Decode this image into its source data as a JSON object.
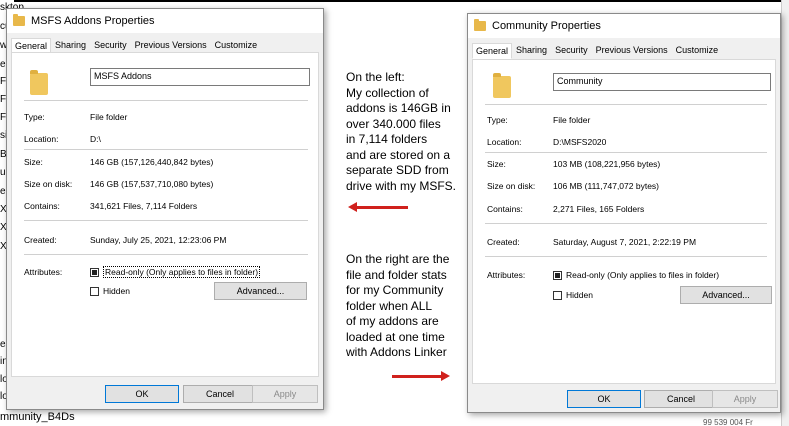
{
  "background": {
    "top_label": "sktop",
    "left_items": [
      "cu",
      "w",
      "e",
      "F",
      "F",
      "F",
      "si",
      "B",
      "u",
      "e",
      "X",
      "X",
      "X",
      "es",
      "in",
      "lo",
      "lo"
    ],
    "bottom_label": "mmunity_B4Ds",
    "bottom_right": "99 539 004   Fr"
  },
  "left_dialog": {
    "title": "MSFS Addons Properties",
    "tabs": [
      "General",
      "Sharing",
      "Security",
      "Previous Versions",
      "Customize"
    ],
    "active_tab": "General",
    "folder_name": "MSFS Addons",
    "fields": {
      "type_label": "Type:",
      "type_value": "File folder",
      "location_label": "Location:",
      "location_value": "D:\\",
      "size_label": "Size:",
      "size_value": "146 GB (157,126,440,842 bytes)",
      "size_on_disk_label": "Size on disk:",
      "size_on_disk_value": "146 GB (157,537,710,080 bytes)",
      "contains_label": "Contains:",
      "contains_value": "341,621 Files, 7,114 Folders",
      "created_label": "Created:",
      "created_value": "Sunday, July 25, 2021, 12:23:06 PM",
      "attributes_label": "Attributes:"
    },
    "readonly_label": "Read-only (Only applies to files in folder)",
    "hidden_label": "Hidden",
    "advanced_label": "Advanced...",
    "ok_label": "OK",
    "cancel_label": "Cancel",
    "apply_label": "Apply"
  },
  "right_dialog": {
    "title": "Community Properties",
    "tabs": [
      "General",
      "Sharing",
      "Security",
      "Previous Versions",
      "Customize"
    ],
    "active_tab": "General",
    "folder_name": "Community",
    "fields": {
      "type_label": "Type:",
      "type_value": "File folder",
      "location_label": "Location:",
      "location_value": "D:\\MSFS2020",
      "size_label": "Size:",
      "size_value": "103 MB (108,221,956 bytes)",
      "size_on_disk_label": "Size on disk:",
      "size_on_disk_value": "106 MB (111,747,072 bytes)",
      "contains_label": "Contains:",
      "contains_value": "2,271 Files, 165 Folders",
      "created_label": "Created:",
      "created_value": "Saturday, August 7, 2021, 2:22:19 PM",
      "attributes_label": "Attributes:"
    },
    "readonly_label": "Read-only (Only applies to files in folder)",
    "hidden_label": "Hidden",
    "advanced_label": "Advanced...",
    "ok_label": "OK",
    "cancel_label": "Cancel",
    "apply_label": "Apply"
  },
  "annotations": {
    "left_note": [
      "On the left:",
      "My collection of",
      "addons is 146GB  in",
      "over 340.000 files",
      "in 7,114 folders",
      "and are stored on a",
      "separate SDD from",
      "drive with my MSFS."
    ],
    "right_note": [
      "On the right are the",
      "file and folder stats",
      "for my Community",
      "folder when ALL",
      "of my addons are",
      "loaded at one time",
      "with Addons Linker"
    ],
    "arrow_color": "#d0211d"
  }
}
